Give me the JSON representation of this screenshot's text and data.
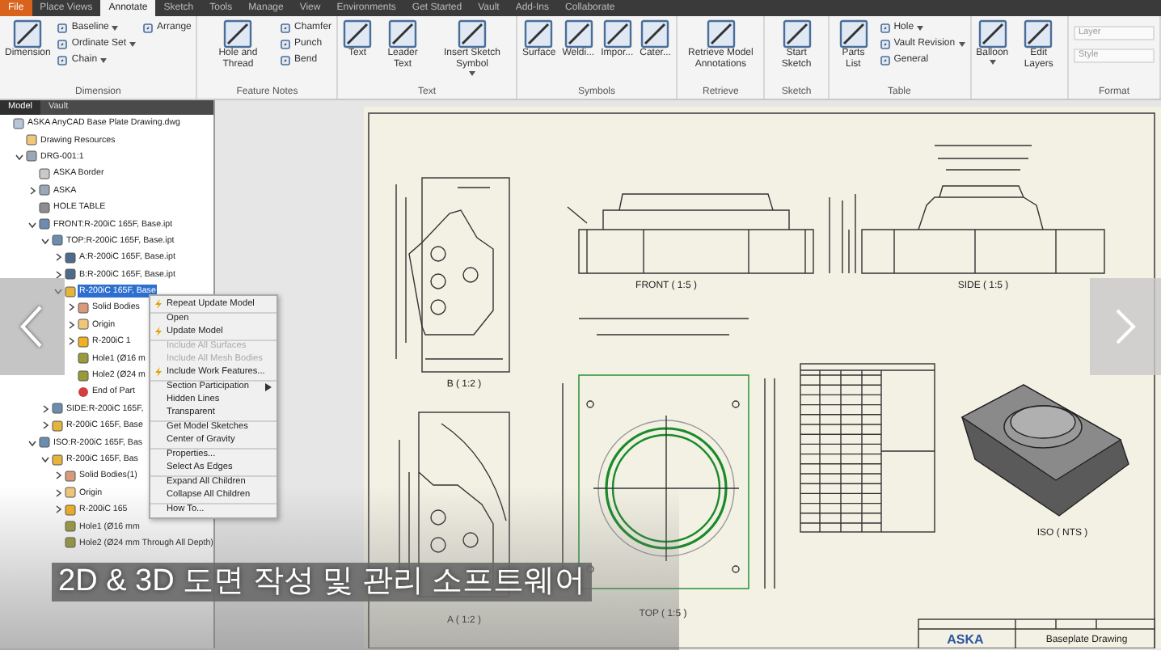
{
  "ribbon_tabs": [
    {
      "label": "File",
      "kind": "app",
      "selected": false
    },
    {
      "label": "Place Views",
      "kind": "tab",
      "selected": false
    },
    {
      "label": "Annotate",
      "kind": "tab",
      "selected": true
    },
    {
      "label": "Sketch",
      "kind": "tab",
      "selected": false
    },
    {
      "label": "Tools",
      "kind": "tab",
      "selected": false
    },
    {
      "label": "Manage",
      "kind": "tab",
      "selected": false
    },
    {
      "label": "View",
      "kind": "tab",
      "selected": false
    },
    {
      "label": "Environments",
      "kind": "tab",
      "selected": false
    },
    {
      "label": "Get Started",
      "kind": "tab",
      "selected": false
    },
    {
      "label": "Vault",
      "kind": "tab",
      "selected": false
    },
    {
      "label": "Add-Ins",
      "kind": "tab",
      "selected": false
    },
    {
      "label": "Collaborate",
      "kind": "tab",
      "selected": false
    }
  ],
  "ribbon_groups": [
    {
      "title": "Dimension",
      "tools": [
        {
          "label": "Dimension",
          "kind": "large"
        },
        {
          "label": "Baseline",
          "kind": "small",
          "dropdown": true
        },
        {
          "label": "Ordinate Set",
          "kind": "small",
          "dropdown": true
        },
        {
          "label": "Chain",
          "kind": "small",
          "dropdown": true
        },
        {
          "label": "Arrange",
          "kind": "single"
        }
      ]
    },
    {
      "title": "Feature Notes",
      "tools": [
        {
          "label": "Hole and Thread",
          "kind": "large"
        },
        {
          "label": "Chamfer",
          "kind": "small"
        },
        {
          "label": "Punch",
          "kind": "small"
        },
        {
          "label": "Bend",
          "kind": "small"
        }
      ]
    },
    {
      "title": "Text",
      "tools": [
        {
          "label": "Text",
          "kind": "large"
        },
        {
          "label": "Leader Text",
          "kind": "large"
        },
        {
          "label": "Insert Sketch Symbol",
          "kind": "large",
          "dropdown": true
        }
      ]
    },
    {
      "title": "Symbols",
      "tools": [
        {
          "label": "Surface",
          "kind": "large"
        },
        {
          "label": "Weldi...",
          "kind": "large"
        },
        {
          "label": "Impor...",
          "kind": "large"
        },
        {
          "label": "Cater...",
          "kind": "large"
        }
      ]
    },
    {
      "title": "Retrieve",
      "tools": [
        {
          "label": "Retrieve Model Annotations",
          "kind": "large"
        }
      ]
    },
    {
      "title": "Sketch",
      "tools": [
        {
          "label": "Start Sketch",
          "kind": "large"
        }
      ]
    },
    {
      "title": "Table",
      "tools": [
        {
          "label": "Parts List",
          "kind": "large"
        },
        {
          "label": "Hole",
          "kind": "small",
          "dropdown": true
        },
        {
          "label": "Vault Revision",
          "kind": "small",
          "dropdown": true
        },
        {
          "label": "General",
          "kind": "small"
        }
      ]
    },
    {
      "tools": [
        {
          "label": "Balloon",
          "kind": "large",
          "dropdown": true
        },
        {
          "label": "Edit Layers",
          "kind": "large"
        }
      ]
    },
    {
      "title": "Format",
      "tools": [
        {
          "label": "Layer",
          "kind": "field"
        },
        {
          "label": "Style",
          "kind": "field"
        }
      ]
    }
  ],
  "browser": {
    "tabs": [
      {
        "label": "Model",
        "selected": true
      },
      {
        "label": "Vault",
        "selected": false
      }
    ],
    "tree": [
      {
        "label": "ASKA AnyCAD Base Plate Drawing.dwg",
        "kind": "file",
        "children": [
          {
            "label": "Drawing Resources",
            "kind": "folder"
          },
          {
            "label": "DRG-001:1",
            "kind": "sheet",
            "expanded": true,
            "children": [
              {
                "label": "ASKA Border",
                "kind": "border"
              },
              {
                "label": "ASKA",
                "kind": "sheet",
                "expanded": false
              },
              {
                "label": "HOLE TABLE",
                "kind": "table"
              },
              {
                "label": "FRONT:R-200iC 165F, Base.ipt",
                "kind": "view",
                "expanded": true,
                "children": [
                  {
                    "label": "TOP:R-200iC 165F, Base.ipt",
                    "kind": "view",
                    "expanded": true,
                    "children": [
                      {
                        "label": "A:R-200iC 165F, Base.ipt",
                        "kind": "detail",
                        "expanded": false
                      },
                      {
                        "label": "B:R-200iC 165F, Base.ipt",
                        "kind": "detail",
                        "expanded": false
                      },
                      {
                        "label": "R-200iC 165F, Base",
                        "kind": "part",
                        "expanded": true,
                        "selected": true,
                        "children": [
                          {
                            "label": "Solid Bodies",
                            "kind": "bodies",
                            "expanded": false
                          },
                          {
                            "label": "Origin",
                            "kind": "folder",
                            "expanded": false
                          },
                          {
                            "label": "R-200iC 1",
                            "kind": "feature",
                            "expanded": false
                          },
                          {
                            "label": "Hole1 (Ø16 m",
                            "kind": "hole"
                          },
                          {
                            "label": "Hole2 (Ø24 m",
                            "kind": "hole"
                          },
                          {
                            "label": "End of Part",
                            "kind": "end"
                          }
                        ]
                      }
                    ]
                  },
                  {
                    "label": "SIDE:R-200iC 165F,",
                    "kind": "view",
                    "expanded": false
                  },
                  {
                    "label": "R-200iC 165F, Base",
                    "kind": "part",
                    "expanded": false
                  }
                ]
              },
              {
                "label": "ISO:R-200iC 165F, Bas",
                "kind": "view",
                "expanded": true,
                "children": [
                  {
                    "label": "R-200iC 165F, Bas",
                    "kind": "part",
                    "expanded": true,
                    "children": [
                      {
                        "label": "Solid Bodies(1)",
                        "kind": "bodies",
                        "expanded": false
                      },
                      {
                        "label": "Origin",
                        "kind": "folder",
                        "expanded": false
                      },
                      {
                        "label": "R-200iC 165",
                        "kind": "feature",
                        "expanded": false
                      },
                      {
                        "label": "Hole1 (Ø16 mm",
                        "kind": "hole"
                      },
                      {
                        "label": "Hole2 (Ø24 mm Through All Depth)",
                        "kind": "hole"
                      }
                    ]
                  }
                ]
              }
            ]
          }
        ]
      }
    ]
  },
  "context_menu": {
    "items": [
      {
        "label": "Repeat Update Model",
        "disabled": false,
        "icon": true
      },
      {
        "label": "Open",
        "disabled": false,
        "separator_before": true
      },
      {
        "label": "Update Model",
        "disabled": false,
        "icon": true
      },
      {
        "label": "Include All Surfaces",
        "disabled": true,
        "separator_before": true
      },
      {
        "label": "Include All Mesh Bodies",
        "disabled": true
      },
      {
        "label": "Include Work Features...",
        "disabled": false,
        "icon": true
      },
      {
        "label": "Section Participation",
        "disabled": false,
        "submenu": true,
        "separator_before": true
      },
      {
        "label": "Hidden Lines",
        "disabled": false
      },
      {
        "label": "Transparent",
        "disabled": false
      },
      {
        "label": "Get Model Sketches",
        "disabled": false,
        "separator_before": true
      },
      {
        "label": "Center of Gravity",
        "disabled": false
      },
      {
        "label": "Properties...",
        "disabled": false,
        "separator_before": true
      },
      {
        "label": "Select As Edges",
        "disabled": false
      },
      {
        "label": "Expand All Children",
        "disabled": false,
        "separator_before": true
      },
      {
        "label": "Collapse All Children",
        "disabled": false
      },
      {
        "label": "How To...",
        "disabled": false,
        "separator_before": true
      }
    ]
  },
  "sheet": {
    "views": [
      {
        "kind": "detail_b",
        "label": "B ( 1:2 )"
      },
      {
        "kind": "front",
        "label": "FRONT ( 1:5 )"
      },
      {
        "kind": "side",
        "label": "SIDE ( 1:5 )"
      },
      {
        "kind": "detail_a",
        "label": "A ( 1:2 )"
      },
      {
        "kind": "top",
        "label": "TOP ( 1:5 )"
      },
      {
        "kind": "iso",
        "label": "ISO ( NTS )"
      }
    ],
    "title_block": {
      "logo": "ASKA",
      "title": "Baseplate Drawing"
    }
  },
  "caption": "2D & 3D 도면 작성 및 관리 소프트웨어"
}
